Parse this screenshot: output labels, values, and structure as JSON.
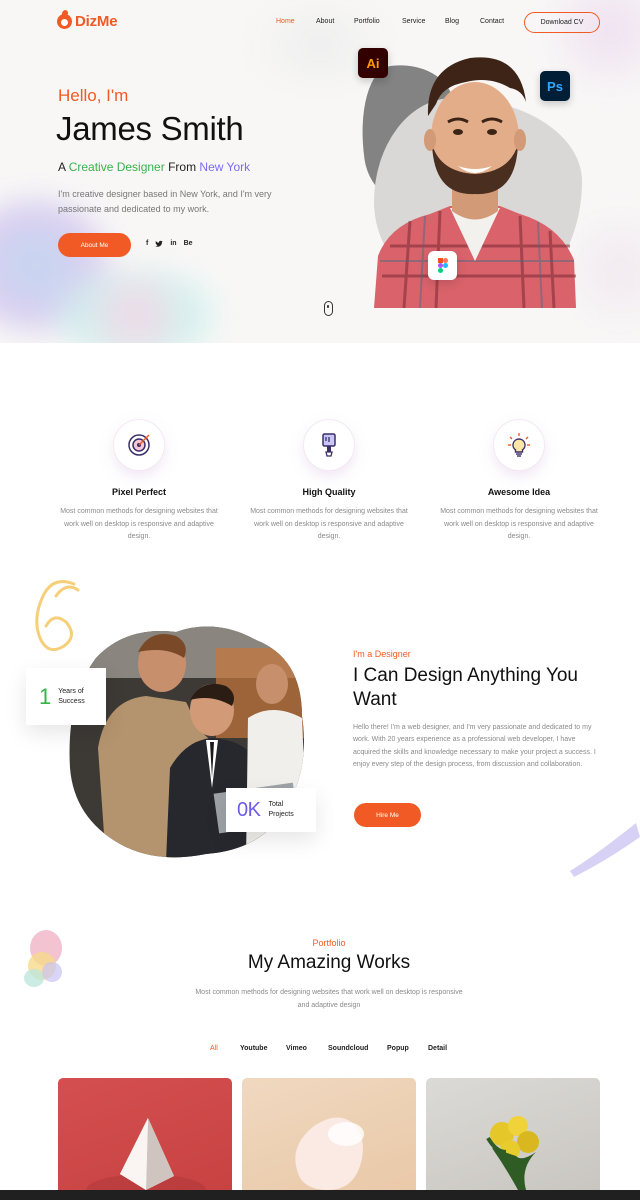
{
  "brand": {
    "name": "DizMe",
    "color": "#f15a24"
  },
  "nav": {
    "items": [
      "Home",
      "About",
      "Portfolio",
      "Service",
      "Blog",
      "Contact"
    ],
    "active": "Home",
    "cv_label": "Download CV"
  },
  "hero": {
    "greeting": "Hello, I'm",
    "name": "James Smith",
    "role_prefix": "A",
    "role": "Creative Designer",
    "role_mid": "From",
    "location": "New York",
    "intro": "I'm creative designer based in New York, and I'm very passionate and dedicated to my work.",
    "cta_label": "About Me",
    "socials": [
      "f",
      "✉",
      "in",
      "Be"
    ],
    "badges": {
      "ai": "Ai",
      "ps": "Ps"
    }
  },
  "features": [
    {
      "icon": "target-icon",
      "title": "Pixel Perfect",
      "desc": "Most common methods for designing websites that work well on desktop is responsive and adaptive design."
    },
    {
      "icon": "paint-brush-icon",
      "title": "High Quality",
      "desc": "Most common methods for designing websites that work well on desktop is responsive and adaptive design."
    },
    {
      "icon": "lightbulb-icon",
      "title": "Awesome Idea",
      "desc": "Most common methods for designing websites that work well on desktop is responsive and adaptive design."
    }
  ],
  "about": {
    "years_value": "1",
    "years_label_1": "Years of",
    "years_label_2": "Success",
    "projects_value": "0K",
    "projects_label_1": "Total",
    "projects_label_2": "Projects",
    "tag": "I'm a Designer",
    "title": "I Can Design Anything You Want",
    "text": "Hello there! I'm a web designer, and I'm very passionate and dedicated to my work. With 20 years experience as a professional web developer, I have acquired the skills and knowledge necessary to make your project a success. I enjoy every step of the design process, from discussion and collaboration.",
    "cta_label": "Hire Me"
  },
  "portfolio": {
    "tag": "Portfolio",
    "title": "My Amazing Works",
    "desc": "Most common methods for designing websites that work well on desktop is responsive and adaptive design",
    "filters": [
      "All",
      "Youtube",
      "Vimeo",
      "Soundcloud",
      "Popup",
      "Detail"
    ],
    "active_filter": "All"
  },
  "colors": {
    "accent": "#f15a24",
    "green": "#38b24a",
    "purple": "#7b6bf2"
  }
}
